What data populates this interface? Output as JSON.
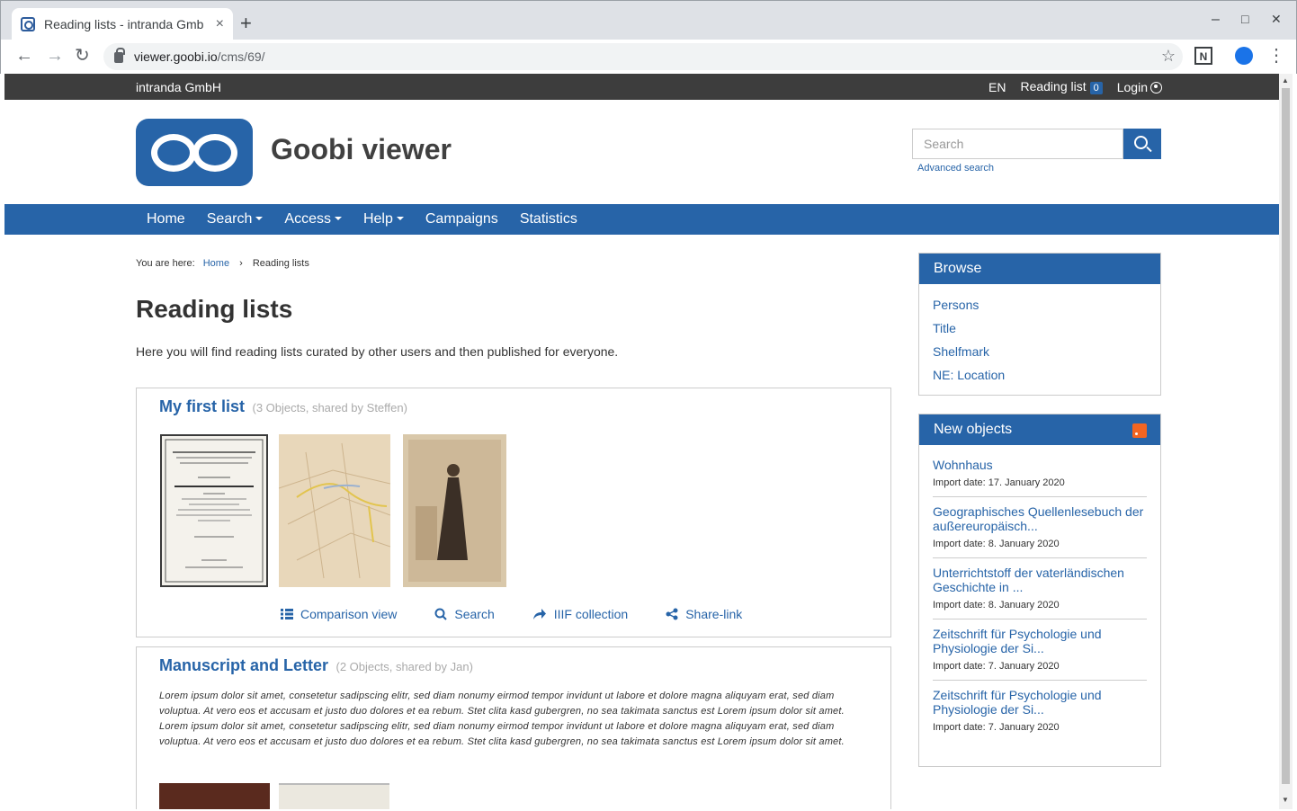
{
  "browser": {
    "tab_title": "Reading lists - intranda Gmb",
    "tab_close": "×",
    "new_tab": "+",
    "url_host": "viewer.goobi.io",
    "url_path": "/cms/69/",
    "back": "←",
    "forward": "→",
    "reload": "↻",
    "star": "☆",
    "minimize": "–",
    "maximize": "□",
    "close": "✕",
    "menu": "⋮",
    "ext_n": "N"
  },
  "topbar": {
    "org": "intranda GmbH",
    "lang": "EN",
    "reading_list_label": "Reading list",
    "reading_list_count": "0",
    "login": "Login"
  },
  "header": {
    "site_title": "Goobi viewer",
    "search_placeholder": "Search",
    "advanced_search": "Advanced search"
  },
  "nav": {
    "items": [
      {
        "label": "Home",
        "dropdown": false
      },
      {
        "label": "Search",
        "dropdown": true
      },
      {
        "label": "Access",
        "dropdown": true
      },
      {
        "label": "Help",
        "dropdown": true
      },
      {
        "label": "Campaigns",
        "dropdown": false
      },
      {
        "label": "Statistics",
        "dropdown": false
      }
    ]
  },
  "breadcrumb": {
    "prefix": "You are here:",
    "home": "Home",
    "separator": "›",
    "current": "Reading lists"
  },
  "main": {
    "title": "Reading lists",
    "intro": "Here you will find reading lists curated by other users and then published for everyone."
  },
  "lists": [
    {
      "title": "My first list",
      "meta": "(3 Objects, shared by Steffen)",
      "actions": {
        "comparison": "Comparison view",
        "search": "Search",
        "iiif": "IIIF collection",
        "share": "Share-link"
      }
    },
    {
      "title": "Manuscript and Letter",
      "meta": "(2 Objects, shared by Jan)",
      "description": "Lorem ipsum dolor sit amet, consetetur sadipscing elitr, sed diam nonumy eirmod tempor invidunt ut labore et dolore magna aliquyam erat, sed diam voluptua. At vero eos et accusam et justo duo dolores et ea rebum. Stet clita kasd gubergren, no sea takimata sanctus est Lorem ipsum dolor sit amet. Lorem ipsum dolor sit amet, consetetur sadipscing elitr, sed diam nonumy eirmod tempor invidunt ut labore et dolore magna aliquyam erat, sed diam voluptua. At vero eos et accusam et justo duo dolores et ea rebum. Stet clita kasd gubergren, no sea takimata sanctus est Lorem ipsum dolor sit amet."
    }
  ],
  "sidebar": {
    "browse": {
      "title": "Browse",
      "items": [
        "Persons",
        "Title",
        "Shelfmark",
        "NE: Location"
      ]
    },
    "new_objects": {
      "title": "New objects",
      "items": [
        {
          "title": "Wohnhaus",
          "date": "Import date: 17. January 2020"
        },
        {
          "title": "Geographisches Quellenlesebuch der außereuropäisch...",
          "date": "Import date: 8. January 2020"
        },
        {
          "title": "Unterrichtstoff der vaterländischen Geschichte in ...",
          "date": "Import date: 8. January 2020"
        },
        {
          "title": "Zeitschrift für Psychologie und Physiologie der Si...",
          "date": "Import date: 7. January 2020"
        },
        {
          "title": "Zeitschrift für Psychologie und Physiologie der Si...",
          "date": "Import date: 7. January 2020"
        }
      ]
    }
  },
  "colors": {
    "primary": "#2764a8",
    "topbar": "#3d3d3d",
    "rss": "#f26522"
  }
}
